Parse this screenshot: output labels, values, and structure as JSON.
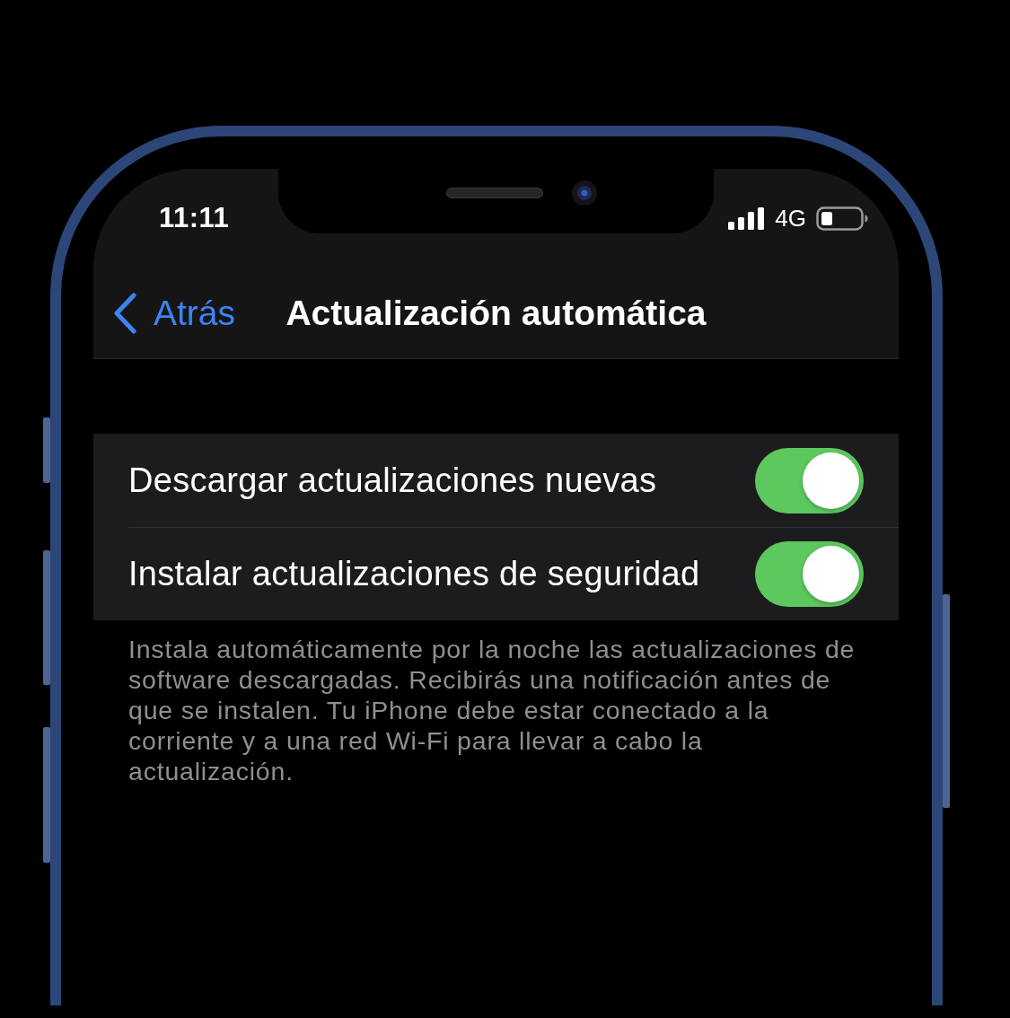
{
  "status_bar": {
    "time": "11:11",
    "network": "4G"
  },
  "nav_bar": {
    "back_label": "Atrás",
    "title": "Actualización automática"
  },
  "settings": [
    {
      "label": "Descargar actualizaciones nuevas",
      "on": true
    },
    {
      "label": "Instalar actualizaciones de seguridad",
      "on": true
    }
  ],
  "footer": "Instala automáticamente por la noche las actualizaciones de software descargadas. Recibirás una notificación antes de que se instalen. Tu iPhone debe estar conectado a la corriente y a una red Wi-Fi para llevar a cabo la actualización."
}
